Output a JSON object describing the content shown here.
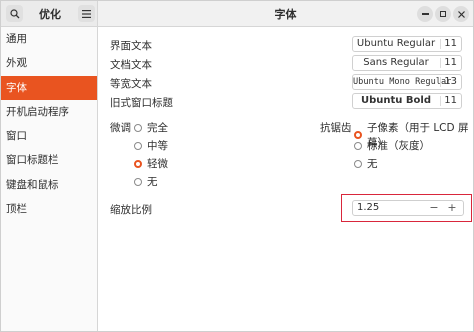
{
  "sidebar": {
    "title": "优化",
    "items": [
      {
        "label": "通用",
        "active": false
      },
      {
        "label": "外观",
        "active": false
      },
      {
        "label": "字体",
        "active": true
      },
      {
        "label": "开机启动程序",
        "active": false
      },
      {
        "label": "窗口",
        "active": false
      },
      {
        "label": "窗口标题栏",
        "active": false
      },
      {
        "label": "键盘和鼠标",
        "active": false
      },
      {
        "label": "顶栏",
        "active": false
      }
    ]
  },
  "header": {
    "title": "字体",
    "search_icon": "search-icon",
    "menu_icon": "hamburger-menu-icon"
  },
  "fonts": {
    "interface": {
      "label": "界面文本",
      "font": "Ubuntu Regular",
      "size": "11"
    },
    "document": {
      "label": "文档文本",
      "font": "Sans Regular",
      "size": "11"
    },
    "monospace": {
      "label": "等宽文本",
      "font": "Ubuntu Mono Regular",
      "size": "13"
    },
    "legacy_title": {
      "label": "旧式窗口标题",
      "font": "Ubuntu Bold",
      "size": "11"
    }
  },
  "hinting": {
    "label": "微调",
    "options": [
      "完全",
      "中等",
      "轻微",
      "无"
    ],
    "selected": "轻微"
  },
  "antialiasing": {
    "label": "抗锯齿",
    "options": [
      "子像素（用于 LCD 屏幕）",
      "标准（灰度）",
      "无"
    ],
    "selected": "子像素（用于 LCD 屏幕）"
  },
  "scaling": {
    "label": "缩放比例",
    "value": "1.25",
    "minus": "−",
    "plus": "+"
  },
  "colors": {
    "accent": "#e95420",
    "highlight_frame": "#d9263b"
  }
}
